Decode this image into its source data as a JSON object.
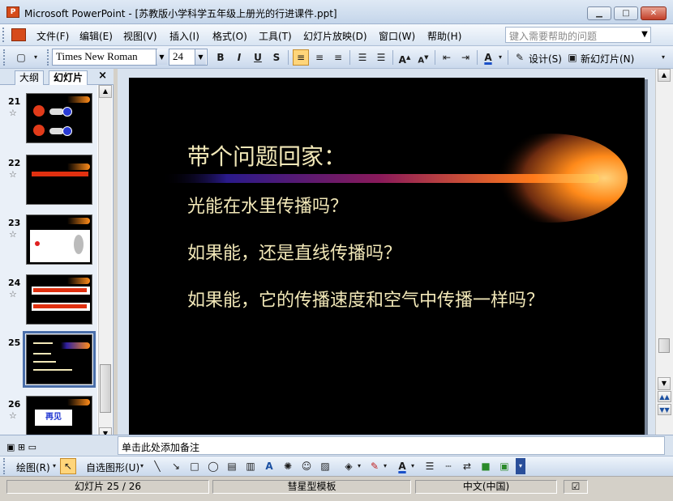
{
  "window": {
    "title": "Microsoft PowerPoint - [苏教版小学科学五年级上册光的行进课件.ppt]",
    "app_icon": "powerpoint-icon",
    "controls": {
      "minimize": "▁",
      "maximize": "□",
      "close": "✕"
    }
  },
  "menu": {
    "items": [
      "文件(F)",
      "编辑(E)",
      "视图(V)",
      "插入(I)",
      "格式(O)",
      "工具(T)",
      "幻灯片放映(D)",
      "窗口(W)",
      "帮助(H)"
    ],
    "help_placeholder": "键入需要帮助的问题"
  },
  "formatting": {
    "font": "Times New Roman",
    "size": "24",
    "bold": "B",
    "italic": "I",
    "underline": "U",
    "shadow": "S",
    "design_label": "设计(S)",
    "new_slide_label": "新幻灯片(N)"
  },
  "pane": {
    "tabs": [
      "大纲",
      "幻灯片"
    ],
    "close": "×",
    "slides": [
      {
        "num": "21"
      },
      {
        "num": "22"
      },
      {
        "num": "23"
      },
      {
        "num": "24"
      },
      {
        "num": "25",
        "selected": true
      },
      {
        "num": "26",
        "thumb_text": "再见"
      }
    ]
  },
  "slide": {
    "title": "带个问题回家：",
    "lines": [
      "光能在水里传播吗？",
      "如果能，还是直线传播吗？",
      "如果能，它的传播速度和空气中传播一样吗？"
    ],
    "colors": {
      "text": "#f2e8b8",
      "background": "#000000",
      "comet": "#ff9a1a"
    }
  },
  "notes": {
    "placeholder": "单击此处添加备注"
  },
  "drawing": {
    "draw_label": "绘图(R)",
    "autoshapes_label": "自选图形(U)"
  },
  "status": {
    "slide_pos": "幻灯片 25 / 26",
    "template": "彗星型模板",
    "language": "中文(中国)"
  }
}
